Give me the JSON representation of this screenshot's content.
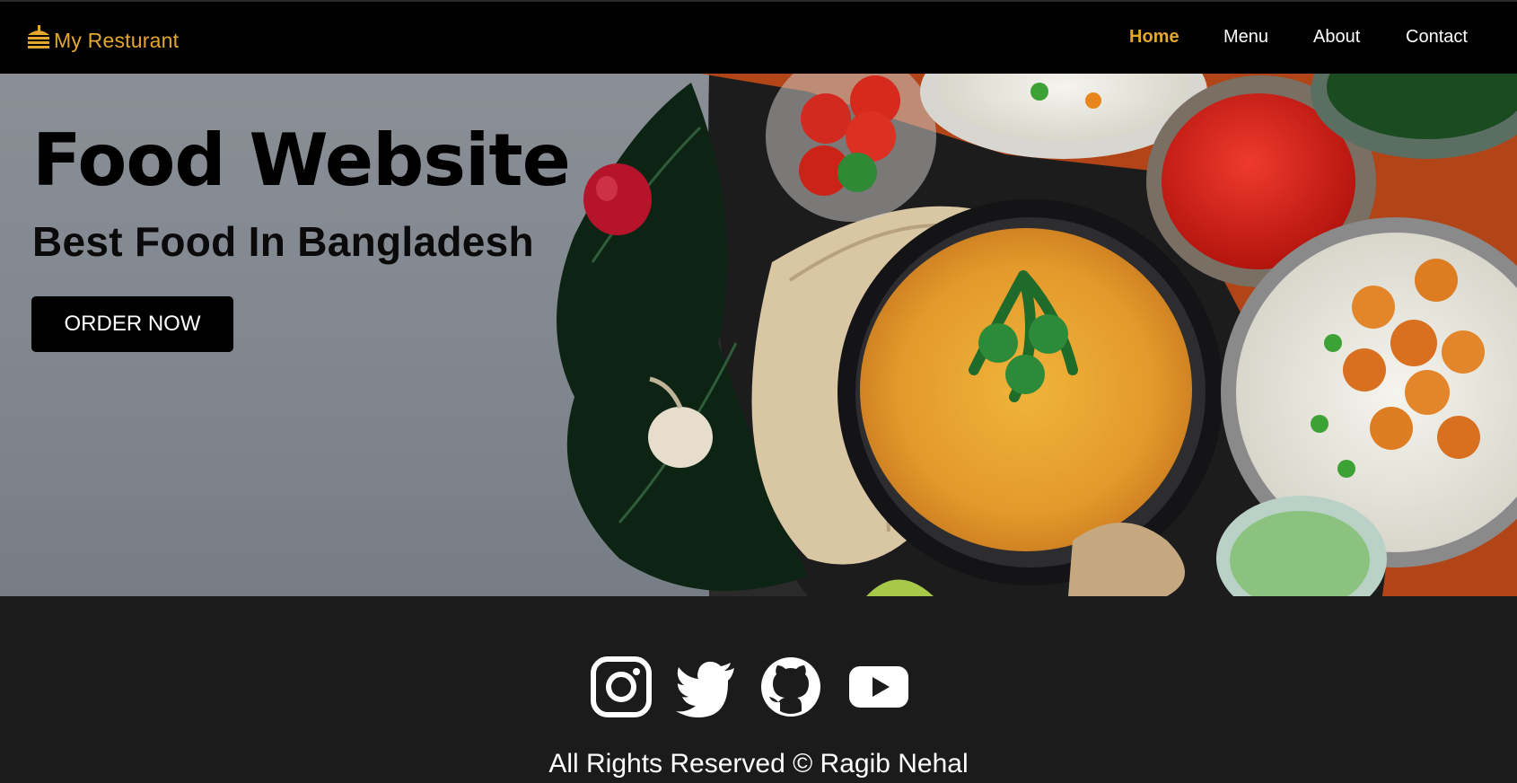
{
  "brand": {
    "name": "My Resturant",
    "icon": "burger-icon"
  },
  "nav": {
    "items": [
      {
        "label": "Home",
        "active": true
      },
      {
        "label": "Menu",
        "active": false
      },
      {
        "label": "About",
        "active": false
      },
      {
        "label": "Contact",
        "active": false
      }
    ]
  },
  "hero": {
    "title": "Food Website",
    "subtitle": "Best Food In Bangladesh",
    "cta_label": "ORDER NOW",
    "image": "food-platter-image"
  },
  "footer": {
    "social": [
      "instagram-icon",
      "twitter-icon",
      "github-icon",
      "youtube-icon"
    ],
    "copyright": "All Rights Reserved © Ragib Nehal"
  },
  "colors": {
    "accent": "#e3a72f",
    "navbar_bg": "#000000",
    "footer_bg": "#1b1b1b",
    "hero_bg": "#868b92"
  }
}
